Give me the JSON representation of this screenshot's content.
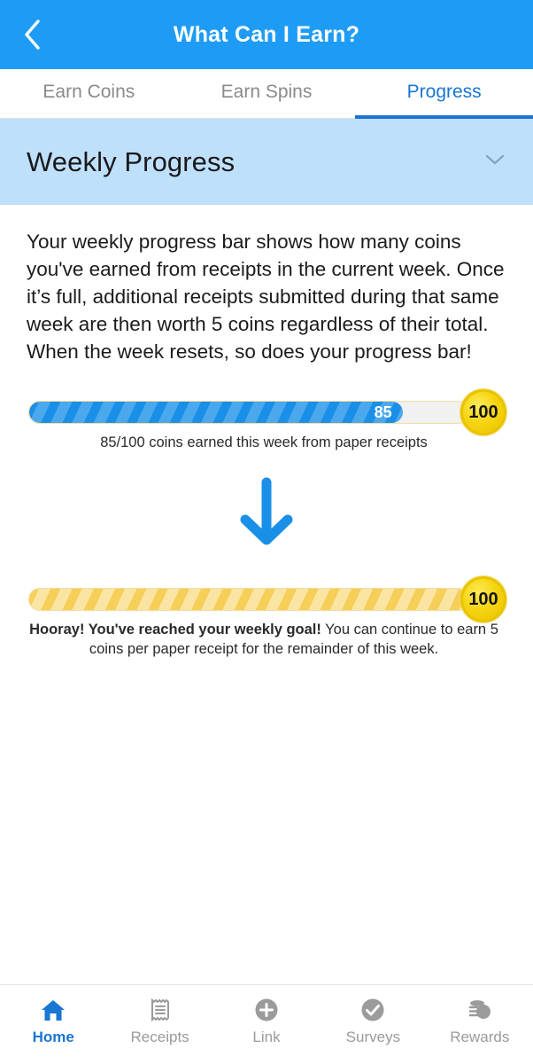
{
  "header": {
    "title": "What Can I Earn?",
    "back_icon": "chevron-left-icon",
    "background": "#1E9CF5"
  },
  "tabs": [
    {
      "label": "Earn Coins",
      "active": false
    },
    {
      "label": "Earn Spins",
      "active": false
    },
    {
      "label": "Progress",
      "active": true
    }
  ],
  "section": {
    "title": "Weekly Progress",
    "expand_icon": "chevron-down-icon",
    "background": "#bfe0fb"
  },
  "main": {
    "intro": "Your weekly progress bar shows how many coins you've earned from receipts in the current week. Once it’s full, additional receipts submitted during that same week are then worth 5 coins regardless of their total. When the week resets, so does your progress bar!",
    "progress_one": {
      "value_label": "85",
      "percent": 85,
      "goal_label": "100",
      "caption": "85/100 coins earned this week from paper receipts",
      "fill_color": "#1a8fe8"
    },
    "arrow_icon": "arrow-down-icon",
    "progress_two": {
      "value_label": "",
      "percent": 100,
      "goal_label": "100",
      "caption_bold": "Hooray! You've reached your weekly goal!",
      "caption_rest": " You can continue to earn 5 coins per paper receipt for the remainder of this week.",
      "fill_color": "#f6cf58"
    }
  },
  "bottom_nav": [
    {
      "label": "Home",
      "icon": "home-icon",
      "active": true
    },
    {
      "label": "Receipts",
      "icon": "receipt-icon",
      "active": false
    },
    {
      "label": "Link",
      "icon": "plus-circle-icon",
      "active": false
    },
    {
      "label": "Surveys",
      "icon": "check-circle-icon",
      "active": false
    },
    {
      "label": "Rewards",
      "icon": "coins-icon",
      "active": false
    }
  ]
}
